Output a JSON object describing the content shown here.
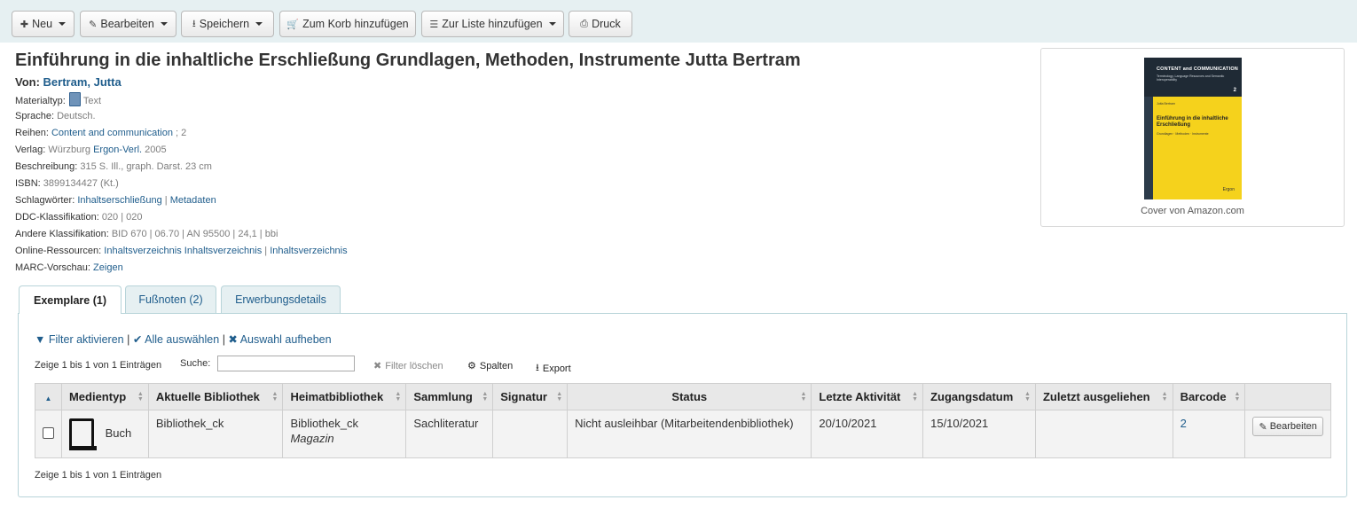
{
  "toolbar": {
    "new": "Neu",
    "edit": "Bearbeiten",
    "save": "Speichern",
    "add_cart": "Zum Korb hinzufügen",
    "add_list": "Zur Liste hinzufügen",
    "print": "Druck"
  },
  "record": {
    "title": "Einführung in die inhaltliche Erschließung Grundlagen, Methoden, Instrumente Jutta Bertram",
    "author_label": "Von:",
    "author": "Bertram, Jutta",
    "materialtype_label": "Materialtyp:",
    "materialtype": "Text",
    "language_label": "Sprache:",
    "language": "Deutsch.",
    "series_label": "Reihen:",
    "series": "Content and communication",
    "series_num": "; 2",
    "publisher_label": "Verlag:",
    "publisher_place": "Würzburg",
    "publisher": "Ergon-Verl.",
    "publisher_year": "2005",
    "description_label": "Beschreibung:",
    "description": "315 S. Ill., graph. Darst. 23 cm",
    "isbn_label": "ISBN:",
    "isbn": "3899134427 (Kt.)",
    "subjects_label": "Schlagwörter:",
    "subject1": "Inhaltserschließung",
    "subject2": "Metadaten",
    "ddc_label": "DDC-Klassifikation:",
    "ddc": "020 | 020",
    "other_class_label": "Andere Klassifikation:",
    "other_class": "BID 670 | 06.70 | AN 95500 | 24,1 | bbi",
    "online_label": "Online-Ressourcen:",
    "online1": "Inhaltsverzeichnis Inhaltsverzeichnis",
    "online2": "Inhaltsverzeichnis",
    "marc_label": "MARC-Vorschau:",
    "marc": "Zeigen"
  },
  "cover": {
    "series": "CONTENT and COMMUNICATION",
    "subtitle": "Terminology, Language Resources and Semantic Interoperability",
    "number": "2",
    "author": "Jutta Bertram",
    "title": "Einführung in die inhaltliche Erschließung",
    "sub": "Grundlagen · Methoden · Instrumente",
    "publisher": "Ergon",
    "caption": "Cover von Amazon.com"
  },
  "tabs": [
    "Exemplare (1)",
    "Fußnoten (2)",
    "Erwerbungsdetails"
  ],
  "holdings": {
    "filter": "Filter aktivieren",
    "select_all": "Alle auswählen",
    "clear": "Auswahl aufheben",
    "info": "Zeige 1 bis 1 von 1 Einträgen",
    "search_label": "Suche:",
    "clear_filter": "Filter löschen",
    "columns": "Spalten",
    "export": "Export",
    "headers": [
      "Medientyp",
      "Aktuelle Bibliothek",
      "Heimatbibliothek",
      "Sammlung",
      "Signatur",
      "Status",
      "Letzte Aktivität",
      "Zugangsdatum",
      "Zuletzt ausgeliehen",
      "Barcode"
    ],
    "row": {
      "itemtype": "Buch",
      "current_library": "Bibliothek_ck",
      "home_library": "Bibliothek_ck",
      "location": "Magazin",
      "collection": "Sachliteratur",
      "callnumber": "",
      "status": "Nicht ausleihbar (Mitarbeitendenbibliothek)",
      "last_seen": "20/10/2021",
      "date_accessioned": "15/10/2021",
      "last_borrowed": "",
      "barcode": "2",
      "edit": "Bearbeiten"
    }
  },
  "colors": {
    "link": "#1f5d8c",
    "toolbar_bg": "#e6f0f2",
    "tab_border": "#b8d4d9"
  }
}
